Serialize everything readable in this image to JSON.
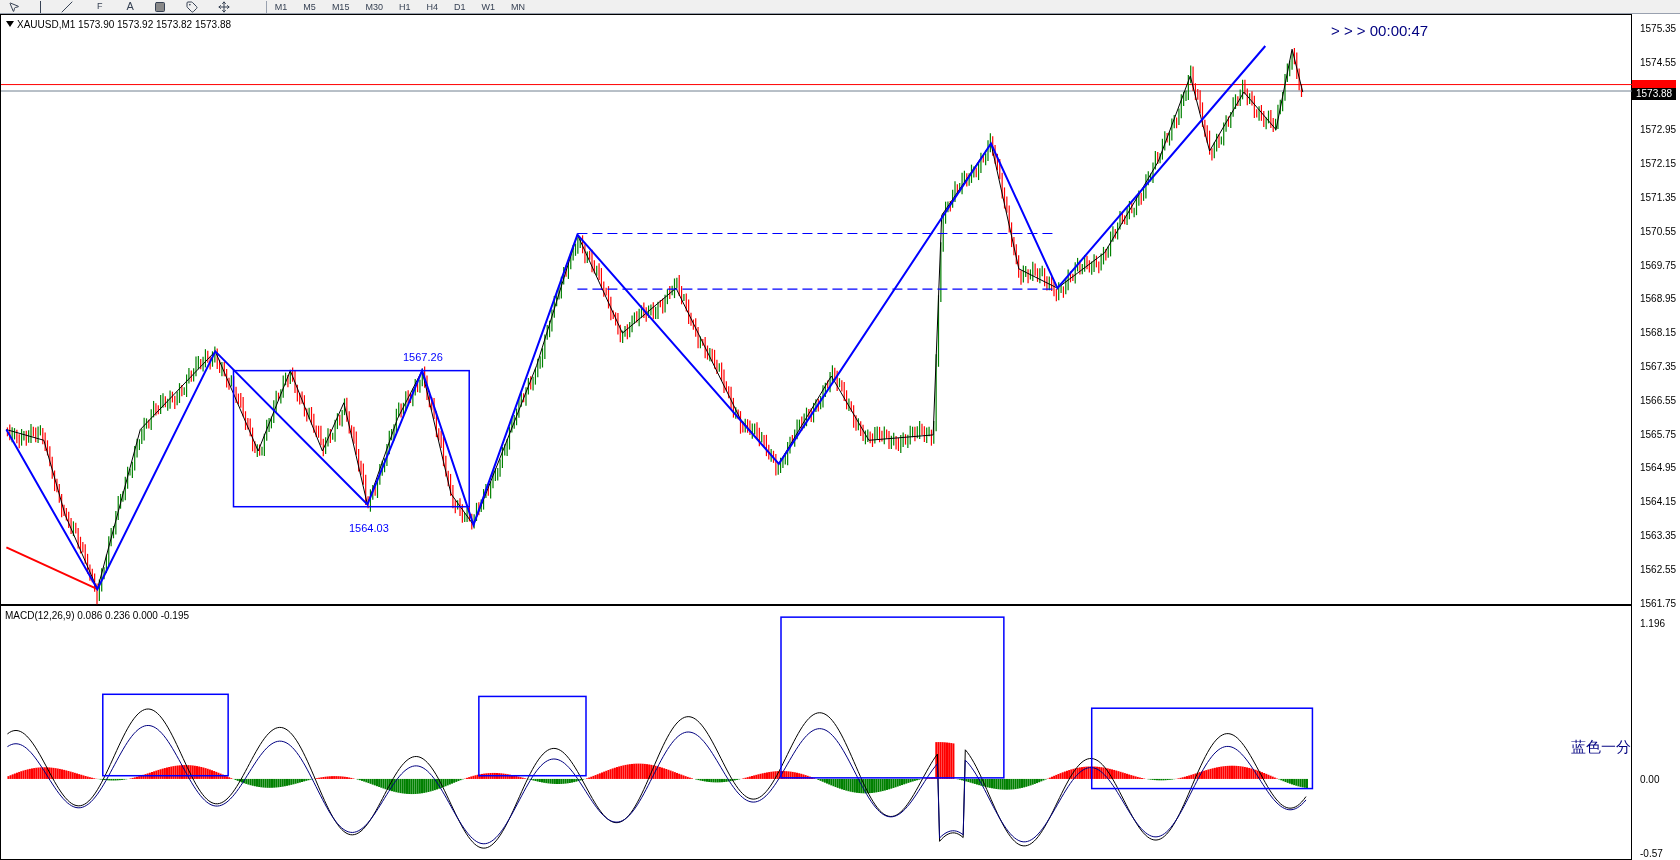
{
  "toolbar": {
    "tools": [
      {
        "kind": "cursor"
      },
      {
        "kind": "vline"
      },
      {
        "kind": "trendline"
      },
      {
        "kind": "fibo",
        "label": "F"
      },
      {
        "kind": "text",
        "label": "A"
      },
      {
        "kind": "rect"
      },
      {
        "kind": "label"
      },
      {
        "kind": "arrows"
      }
    ],
    "timeframes": [
      "M1",
      "M5",
      "M15",
      "M30",
      "H1",
      "H4",
      "D1",
      "W1",
      "MN"
    ]
  },
  "chart": {
    "info": "XAUUSD,M1  1573.90 1573.92 1573.82 1573.88",
    "countdown": "> > >  00:00:47",
    "annotations": [
      {
        "kind": "high",
        "text": "1567.26"
      },
      {
        "kind": "low",
        "text": "1564.03"
      }
    ],
    "price_axis": {
      "ticks_above": [
        "1575.35",
        "1574.55"
      ],
      "current_price": "1573.88",
      "ticks_below": [
        "1572.95",
        "1572.15",
        "1571.35",
        "1570.55",
        "1569.75",
        "1568.95",
        "1568.15",
        "1567.35",
        "1566.55",
        "1565.75",
        "1564.95",
        "1564.15",
        "1563.35",
        "1562.55",
        "1561.75"
      ]
    }
  },
  "macd": {
    "label": "MACD(12,26,9) 0.086 0.236 0.000 -0.195",
    "note": "蓝色一分",
    "axis": [
      "1.196",
      "0.00",
      "-0.57"
    ]
  }
}
